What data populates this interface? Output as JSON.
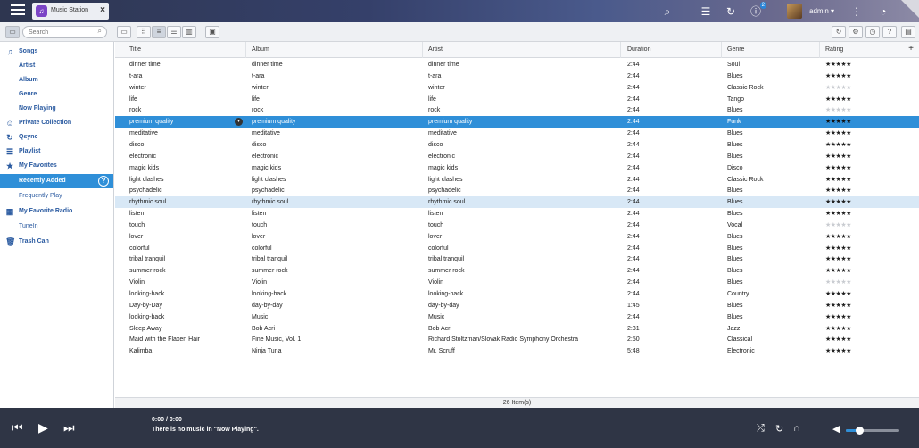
{
  "app": {
    "tab_title": "Music Station",
    "tab_icon": "music-note-icon",
    "user": "admin ▾",
    "notification_count": "2"
  },
  "toolbar": {
    "search_placeholder": "Search"
  },
  "sidebar": {
    "items": [
      {
        "label": "Songs",
        "icon": "music-note-icon"
      },
      {
        "label": "Artist"
      },
      {
        "label": "Album"
      },
      {
        "label": "Genre"
      },
      {
        "label": "Now Playing"
      },
      {
        "label": "Private Collection",
        "icon": "person-icon"
      },
      {
        "label": "Qsync",
        "icon": "sync-icon"
      },
      {
        "label": "Playlist",
        "icon": "playlist-icon"
      },
      {
        "label": "My Favorites",
        "icon": "star-icon"
      },
      {
        "label": "Recently Added"
      },
      {
        "label": "Frequently Play"
      },
      {
        "label": "My Favorite Radio",
        "icon": "radio-icon"
      },
      {
        "label": "TuneIn"
      },
      {
        "label": "Trash Can",
        "icon": "trash-icon"
      }
    ]
  },
  "table": {
    "columns": [
      "Title",
      "Album",
      "Artist",
      "Duration",
      "Genre",
      "Rating"
    ],
    "rows": [
      {
        "title": "dinner time",
        "album": "dinner time",
        "artist": "dinner time",
        "duration": "2:44",
        "genre": "Soul",
        "rating": 5
      },
      {
        "title": "t-ara",
        "album": "t-ara",
        "artist": "t-ara",
        "duration": "2:44",
        "genre": "Blues",
        "rating": 5
      },
      {
        "title": "winter",
        "album": "winter",
        "artist": "winter",
        "duration": "2:44",
        "genre": "Classic Rock",
        "rating": 0
      },
      {
        "title": "life",
        "album": "life",
        "artist": "life",
        "duration": "2:44",
        "genre": "Tango",
        "rating": 5
      },
      {
        "title": "rock",
        "album": "rock",
        "artist": "rock",
        "duration": "2:44",
        "genre": "Blues",
        "rating": 0
      },
      {
        "title": "premium quality",
        "album": "premium quality",
        "artist": "premium quality",
        "duration": "2:44",
        "genre": "Funk",
        "rating": 5
      },
      {
        "title": "meditative",
        "album": "meditative",
        "artist": "meditative",
        "duration": "2:44",
        "genre": "Blues",
        "rating": 5
      },
      {
        "title": "disco",
        "album": "disco",
        "artist": "disco",
        "duration": "2:44",
        "genre": "Blues",
        "rating": 5
      },
      {
        "title": "electronic",
        "album": "electronic",
        "artist": "electronic",
        "duration": "2:44",
        "genre": "Blues",
        "rating": 5
      },
      {
        "title": "magic kids",
        "album": "magic kids",
        "artist": "magic kids",
        "duration": "2:44",
        "genre": "Disco",
        "rating": 5
      },
      {
        "title": "light clashes",
        "album": "light clashes",
        "artist": "light clashes",
        "duration": "2:44",
        "genre": "Classic Rock",
        "rating": 5
      },
      {
        "title": "psychadelic",
        "album": "psychadelic",
        "artist": "psychadelic",
        "duration": "2:44",
        "genre": "Blues",
        "rating": 5
      },
      {
        "title": "rhythmic soul",
        "album": "rhythmic soul",
        "artist": "rhythmic soul",
        "duration": "2:44",
        "genre": "Blues",
        "rating": 5
      },
      {
        "title": "listen",
        "album": "listen",
        "artist": "listen",
        "duration": "2:44",
        "genre": "Blues",
        "rating": 5
      },
      {
        "title": "touch",
        "album": "touch",
        "artist": "touch",
        "duration": "2:44",
        "genre": "Vocal",
        "rating": 0
      },
      {
        "title": "lover",
        "album": "lover",
        "artist": "lover",
        "duration": "2:44",
        "genre": "Blues",
        "rating": 5
      },
      {
        "title": "colorful",
        "album": "colorful",
        "artist": "colorful",
        "duration": "2:44",
        "genre": "Blues",
        "rating": 5
      },
      {
        "title": "tribal tranquil",
        "album": "tribal tranquil",
        "artist": "tribal tranquil",
        "duration": "2:44",
        "genre": "Blues",
        "rating": 5
      },
      {
        "title": "summer rock",
        "album": "summer rock",
        "artist": "summer rock",
        "duration": "2:44",
        "genre": "Blues",
        "rating": 5
      },
      {
        "title": "Violin",
        "album": "Violin",
        "artist": "Violin",
        "duration": "2:44",
        "genre": "Blues",
        "rating": 0
      },
      {
        "title": "looking-back",
        "album": "looking-back",
        "artist": "looking-back",
        "duration": "2:44",
        "genre": "Country",
        "rating": 5
      },
      {
        "title": "Day-by-Day",
        "album": "day-by-day",
        "artist": "day-by-day",
        "duration": "1:45",
        "genre": "Blues",
        "rating": 5
      },
      {
        "title": "looking-back",
        "album": "Music",
        "artist": "Music",
        "duration": "2:44",
        "genre": "Blues",
        "rating": 5
      },
      {
        "title": "Sleep Away",
        "album": "Bob Acri",
        "artist": "Bob Acri",
        "duration": "2:31",
        "genre": "Jazz",
        "rating": 5
      },
      {
        "title": "Maid with the Flaxen Hair",
        "album": "Fine Music, Vol. 1",
        "artist": "Richard Stoltzman/Slovak Radio Symphony Orchestra",
        "duration": "2:50",
        "genre": "Classical",
        "rating": 5
      },
      {
        "title": "Kalimba",
        "album": "Ninja Tuna",
        "artist": "Mr. Scruff",
        "duration": "5:48",
        "genre": "Electronic",
        "rating": 5
      }
    ],
    "selected_row": 5,
    "highlighted_row": 12,
    "status": "26 Item(s)"
  },
  "player": {
    "time": "0:00 / 0:00",
    "message": "There is no music in \"Now Playing\".",
    "volume": 0.25
  },
  "colors": {
    "accent": "#2f8fd8",
    "player_bg": "#2f3545"
  }
}
